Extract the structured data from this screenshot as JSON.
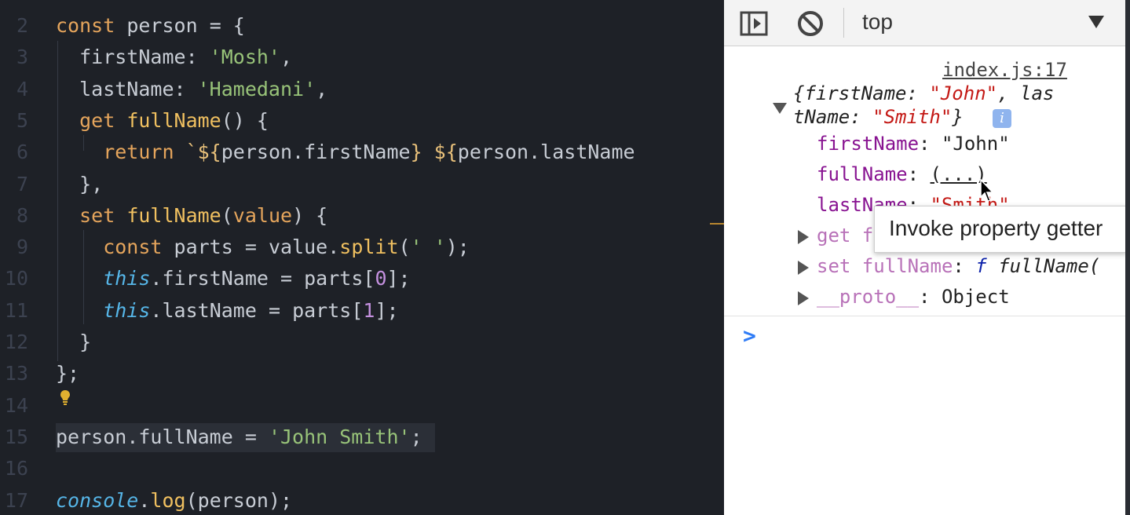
{
  "editor": {
    "lines": [
      {
        "n": "2",
        "tokens": [
          [
            "kw",
            "const"
          ],
          [
            "txt",
            " person "
          ],
          [
            "op",
            "="
          ],
          [
            "punc",
            " {"
          ]
        ]
      },
      {
        "n": "3",
        "tokens": [
          [
            "prop",
            "  firstName: "
          ],
          [
            "str",
            "'Mosh'"
          ],
          [
            "punc",
            ","
          ]
        ]
      },
      {
        "n": "4",
        "tokens": [
          [
            "prop",
            "  lastName: "
          ],
          [
            "str",
            "'Hamedani'"
          ],
          [
            "punc",
            ","
          ]
        ]
      },
      {
        "n": "5",
        "tokens": [
          [
            "kw",
            "  get "
          ],
          [
            "fn",
            "fullName"
          ],
          [
            "punc",
            "() {"
          ]
        ]
      },
      {
        "n": "6",
        "tokens": [
          [
            "kw",
            "    return "
          ],
          [
            "tmpl",
            "`${"
          ],
          [
            "txt",
            "person"
          ],
          [
            "punc",
            "."
          ],
          [
            "prop",
            "firstName"
          ],
          [
            "tmpl",
            "} ${"
          ],
          [
            "txt",
            "person"
          ],
          [
            "punc",
            "."
          ],
          [
            "prop",
            "lastName"
          ]
        ]
      },
      {
        "n": "7",
        "tokens": [
          [
            "punc",
            "  },"
          ]
        ]
      },
      {
        "n": "8",
        "tokens": [
          [
            "kw",
            "  set "
          ],
          [
            "fn",
            "fullName"
          ],
          [
            "punc",
            "("
          ],
          [
            "param",
            "value"
          ],
          [
            "punc",
            ") {"
          ]
        ]
      },
      {
        "n": "9",
        "tokens": [
          [
            "kw",
            "    const "
          ],
          [
            "txt",
            "parts "
          ],
          [
            "op",
            "= "
          ],
          [
            "txt",
            "value"
          ],
          [
            "punc",
            "."
          ],
          [
            "fn",
            "split"
          ],
          [
            "punc",
            "("
          ],
          [
            "str",
            "' '"
          ],
          [
            "punc",
            ");"
          ]
        ]
      },
      {
        "n": "10",
        "tokens": [
          [
            "kwi",
            "    this"
          ],
          [
            "punc",
            "."
          ],
          [
            "prop",
            "firstName "
          ],
          [
            "op",
            "= "
          ],
          [
            "txt",
            "parts"
          ],
          [
            "punc",
            "["
          ],
          [
            "num",
            "0"
          ],
          [
            "punc",
            "];"
          ]
        ]
      },
      {
        "n": "11",
        "tokens": [
          [
            "kwi",
            "    this"
          ],
          [
            "punc",
            "."
          ],
          [
            "prop",
            "lastName "
          ],
          [
            "op",
            "= "
          ],
          [
            "txt",
            "parts"
          ],
          [
            "punc",
            "["
          ],
          [
            "num",
            "1"
          ],
          [
            "punc",
            "];"
          ]
        ]
      },
      {
        "n": "12",
        "tokens": [
          [
            "punc",
            "  }"
          ]
        ]
      },
      {
        "n": "13",
        "tokens": [
          [
            "punc",
            "};"
          ]
        ]
      },
      {
        "n": "14",
        "tokens": []
      },
      {
        "n": "15",
        "tokens": [
          [
            "txt",
            "person"
          ],
          [
            "punc",
            "."
          ],
          [
            "prop",
            "fullName "
          ],
          [
            "op",
            "= "
          ],
          [
            "str",
            "'John Smith'"
          ],
          [
            "punc",
            ";"
          ]
        ],
        "highlight": true
      },
      {
        "n": "16",
        "tokens": []
      },
      {
        "n": "17",
        "tokens": [
          [
            "kwi",
            "console"
          ],
          [
            "punc",
            "."
          ],
          [
            "fn",
            "log"
          ],
          [
            "punc",
            "("
          ],
          [
            "txt",
            "person"
          ],
          [
            "punc",
            ");"
          ]
        ]
      }
    ],
    "lightbulb_icon": "lightbulb-icon"
  },
  "devtools": {
    "toolbar": {
      "sidebar_icon": "show-sidebar-icon",
      "clear_icon": "clear-console-icon",
      "context": "top",
      "dropdown_icon": "chevron-down-icon"
    },
    "console": {
      "source": "index.js:17",
      "summary_line1_a": "{firstName",
      "summary_line1_b": ": ",
      "summary_line1_c": "\"John\"",
      "summary_line1_d": ", las",
      "summary_line2_a": "tName",
      "summary_line2_b": ": ",
      "summary_line2_c": "\"Smith\"",
      "summary_line2_d": "}",
      "info_badge": "i",
      "props": [
        {
          "key": "firstName",
          "sep": ": ",
          "value": "\"John\""
        },
        {
          "key": "fullName",
          "sep": ": ",
          "value": "(...)"
        },
        {
          "key": "lastName",
          "sep": ": ",
          "value": "\"Smith\""
        }
      ],
      "getter_row": {
        "prefix": "get f",
        "rest": ""
      },
      "setter_row": {
        "prefix": "set fullName",
        "sep": ": ",
        "f": "f",
        "sig": " fullName("
      },
      "proto_row": {
        "key": "__proto__",
        "sep": ": ",
        "value": "Object"
      },
      "prompt": ">"
    },
    "tooltip": "Invoke property getter"
  },
  "colors": {
    "editor_bg": "#1e2127",
    "keyword": "#e5a55c",
    "string": "#98c379",
    "function": "#f0c060",
    "console_key": "#881391",
    "console_string": "#c41a16"
  }
}
